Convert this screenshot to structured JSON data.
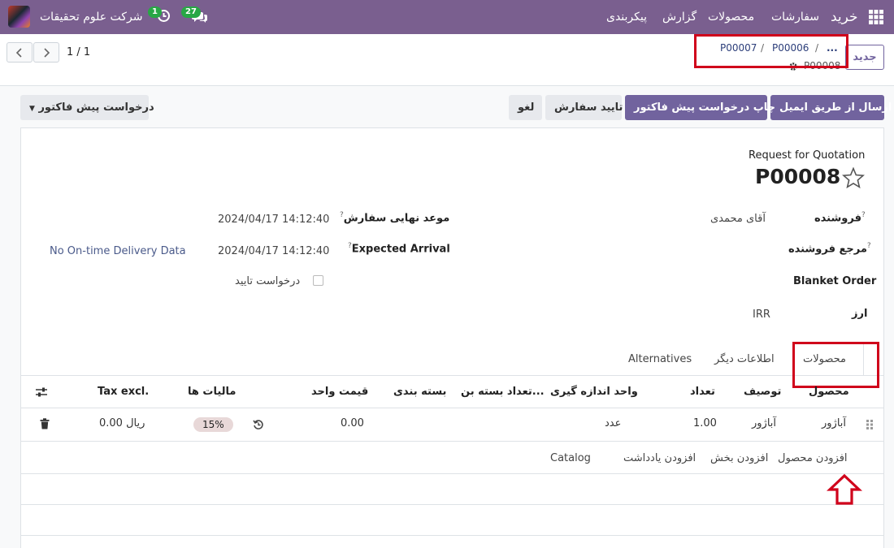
{
  "navbar": {
    "app_name": "خرید",
    "menu": [
      "سفارشات",
      "محصولات",
      "گزارش",
      "پیکربندی"
    ],
    "company": "شرکت علوم تحقیقات",
    "chat_count": "27",
    "activity_count": "1"
  },
  "control_panel": {
    "new_button": "جدید",
    "breadcrumbs": [
      "P00007",
      "P00006"
    ],
    "breadcrumb_sep": "/",
    "breadcrumb_more": "...",
    "current_record": "P00008",
    "pager": "1 / 1"
  },
  "action_buttons": {
    "send_email": "ارسال از طریق ایمیل",
    "print_rfq": "چاپ درخواست پیش فاکتور",
    "confirm_order": "تایید سفارش",
    "cancel": "لغو",
    "status": "درخواست پیش فاکتور"
  },
  "form": {
    "doc_type": "Request for Quotation",
    "doc_name": "P00008",
    "vendor_label": "فروشنده",
    "vendor_value": "آقای محمدی",
    "vendor_ref_label": "مرجع فروشنده",
    "blanket_order_label": "Blanket Order",
    "currency_label": "ارز",
    "currency_value": "IRR",
    "order_deadline_label": "موعد نهایی سفارش",
    "order_deadline_value": "2024/04/17 14:12:40",
    "expected_arrival_label": "Expected Arrival",
    "expected_arrival_value": "2024/04/17 14:12:40",
    "on_time_delivery": "No On-time Delivery Data",
    "ask_confirmation_label": "درخواست تایید"
  },
  "tabs": [
    "محصولات",
    "اطلاعات دیگر",
    "Alternatives"
  ],
  "table": {
    "headers": {
      "product": "محصول",
      "description": "توصیف",
      "quantity": "تعداد",
      "uom": "واحد اندازه گیری",
      "packaging_qty": "تعداد بسته بن...",
      "packaging": "بسته بندی",
      "unit_price": "قیمت واحد",
      "taxes": "مالیات ها",
      "subtotal": "Tax excl."
    },
    "rows": [
      {
        "product": "آباژور",
        "description": "آباژور",
        "quantity": "1.00",
        "uom": "عدد",
        "unit_price": "0.00",
        "tax": "15%",
        "subtotal": "0.00 ریال"
      }
    ],
    "add_product": "افزودن محصول",
    "add_section": "افزودن بخش",
    "add_note": "افزودن یادداشت",
    "catalog": "Catalog"
  },
  "icons": {
    "apps": "grid-icon",
    "chat": "chat-bubbles-icon",
    "activity": "clock-icon",
    "star": "star-icon",
    "gear": "gear-icon",
    "settings": "sliders-icon",
    "delete": "trash-icon",
    "reset": "history-icon",
    "drag": "drag-handle-icon",
    "annotation": "red-up-arrow"
  },
  "colors": {
    "navbar": "#7a5f8f",
    "primary": "#71639e",
    "annotation": "#d0021b",
    "badge": "#28a745"
  }
}
